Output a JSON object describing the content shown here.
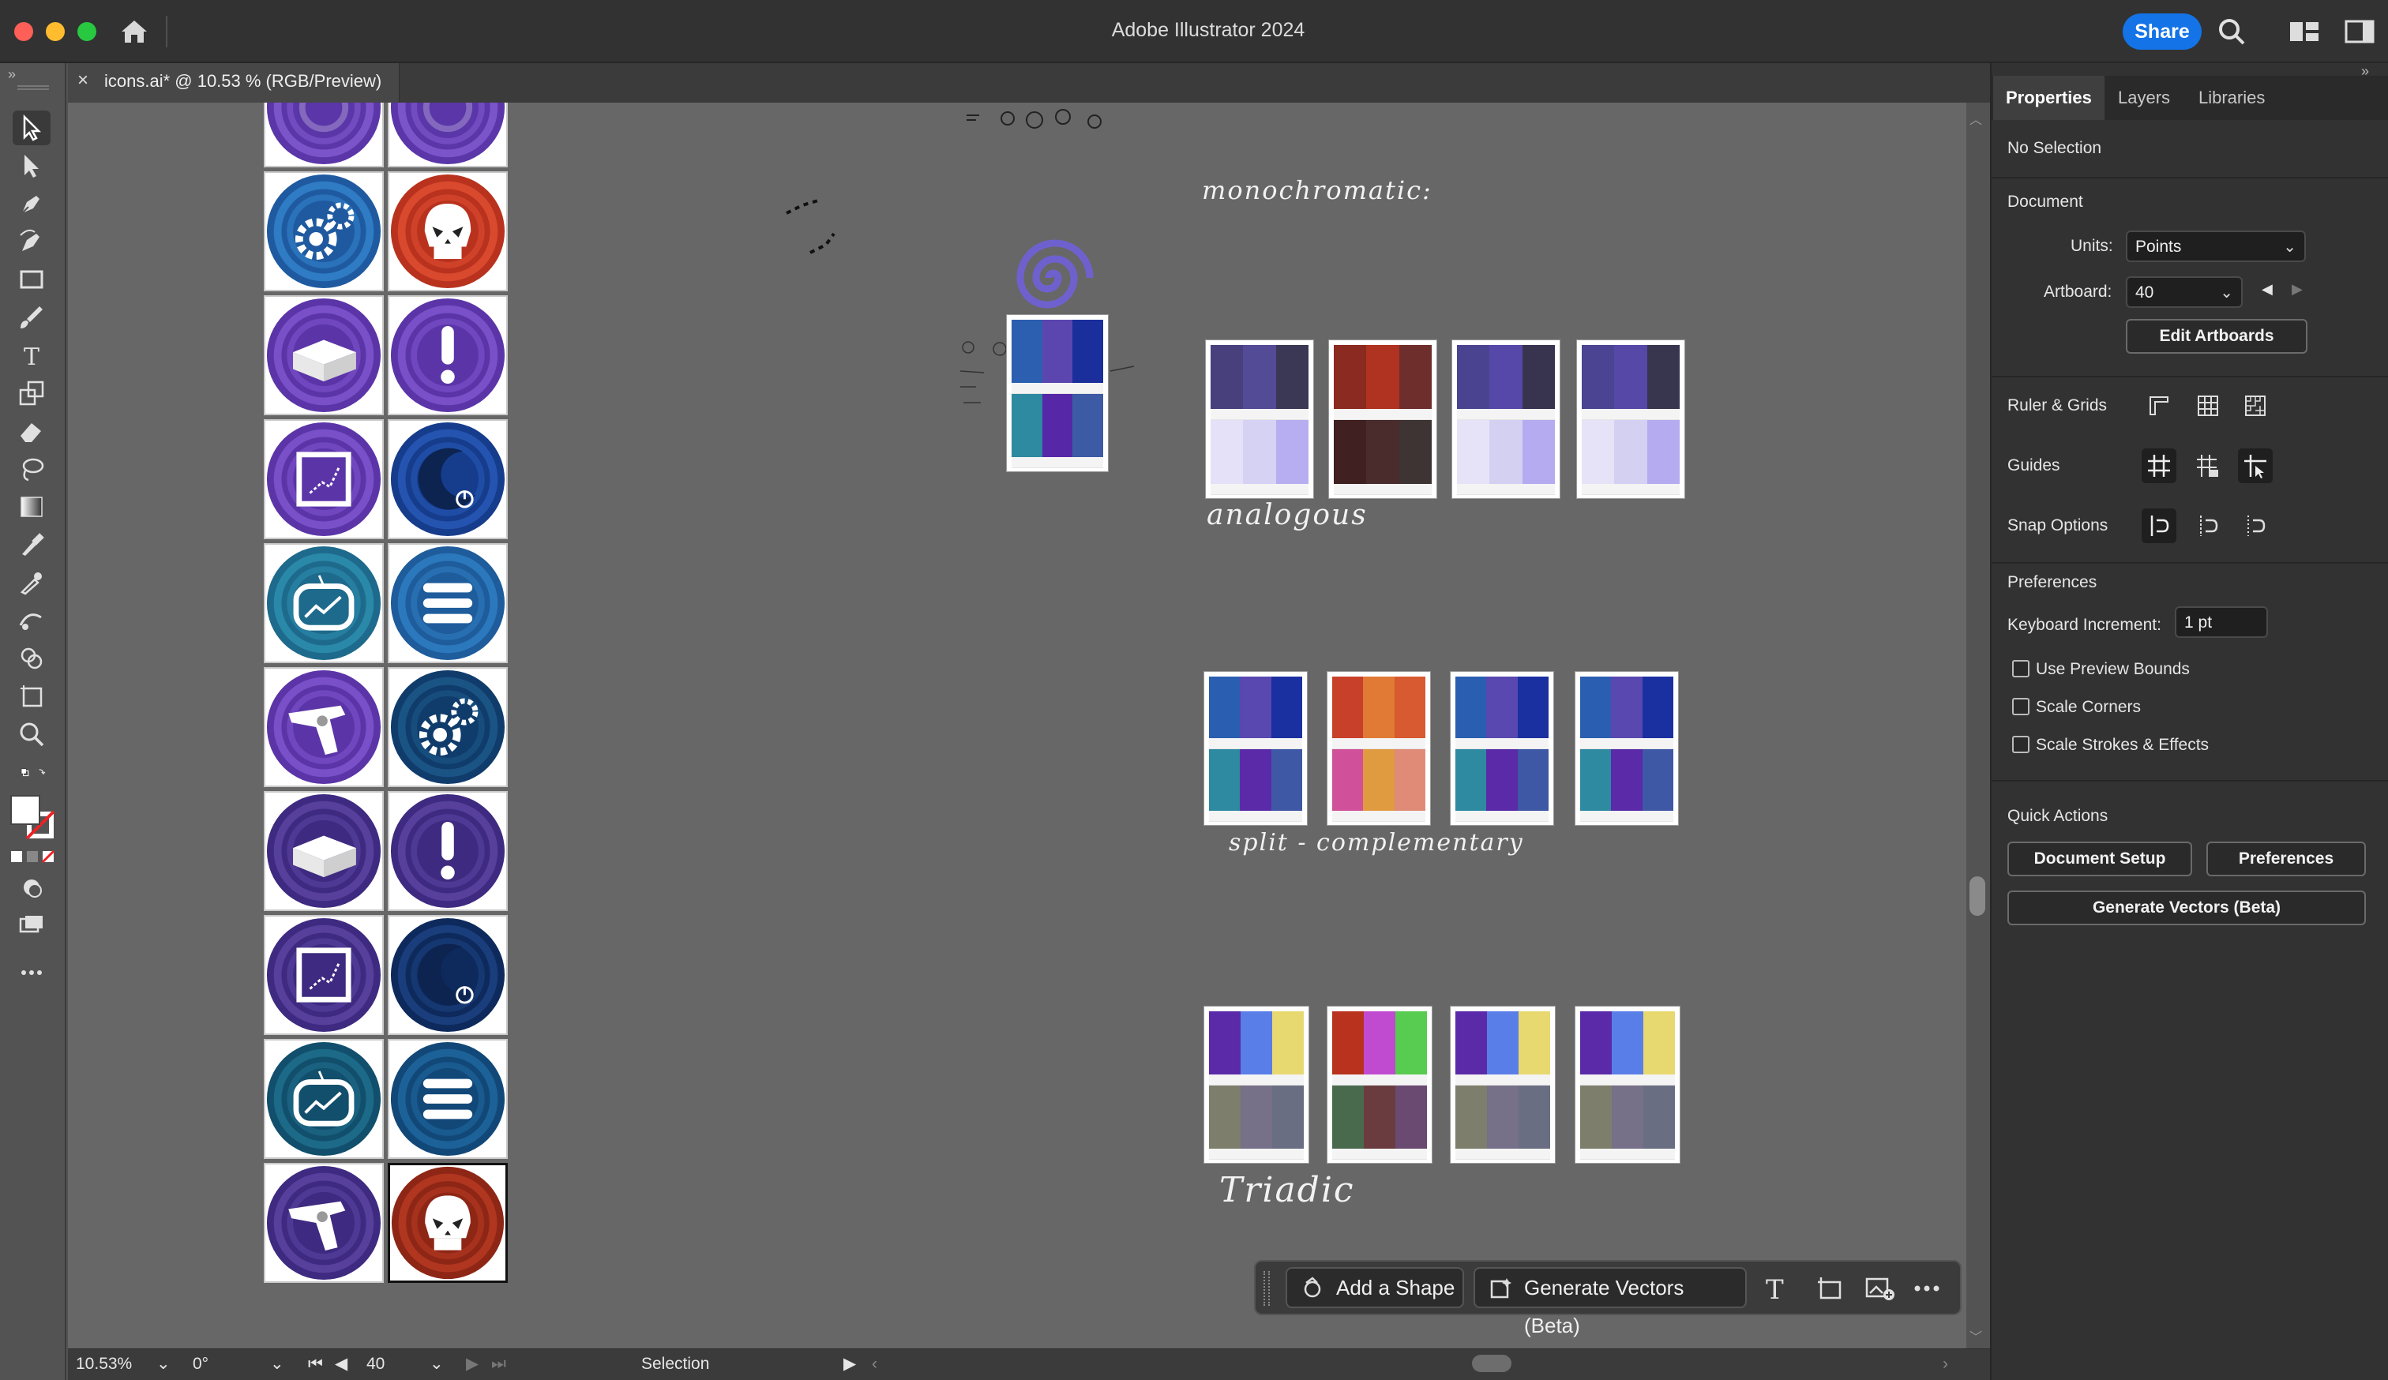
{
  "window": {
    "title": "Adobe Illustrator 2024",
    "share_label": "Share"
  },
  "document": {
    "tab_title": "icons.ai* @ 10.53 % (RGB/Preview)",
    "close_glyph": "×"
  },
  "status_bar": {
    "zoom": "10.53%",
    "rotation": "0°",
    "artboard": "40",
    "mode": "Selection"
  },
  "canvas_labels": {
    "monochromatic": "monochromatic:",
    "analogous": "analogous",
    "split_complementary": "split - complementary",
    "triadic": "Triadic"
  },
  "icons": [
    {
      "name": "spiral",
      "bg": "#5a36a8",
      "ring": "#7b54c9",
      "glyph": "spiral"
    },
    {
      "name": "spiral",
      "bg": "#5a36a8",
      "ring": "#7b54c9",
      "glyph": "spiral"
    },
    {
      "name": "gears",
      "bg": "#1f5aa0",
      "ring": "#2f7cc4",
      "glyph": "gears"
    },
    {
      "name": "skull",
      "bg": "#b8321e",
      "ring": "#d9492e",
      "glyph": "skull"
    },
    {
      "name": "briefcase",
      "bg": "#5b35a8",
      "ring": "#7950c8",
      "glyph": "case"
    },
    {
      "name": "exclamation",
      "bg": "#5b35a8",
      "ring": "#7950c8",
      "glyph": "excl"
    },
    {
      "name": "chart-frame",
      "bg": "#5b35a8",
      "ring": "#7950c8",
      "glyph": "frame"
    },
    {
      "name": "moon",
      "bg": "#163c8c",
      "ring": "#2454b0",
      "glyph": "moon"
    },
    {
      "name": "tv-chart",
      "bg": "#1e6a8c",
      "ring": "#2a88a8",
      "glyph": "tv"
    },
    {
      "name": "menu",
      "bg": "#1e5c9c",
      "ring": "#2c78bc",
      "glyph": "menu"
    },
    {
      "name": "revolver",
      "bg": "#5b35a8",
      "ring": "#7950c8",
      "glyph": "gun"
    },
    {
      "name": "gears-dark",
      "bg": "#103c6c",
      "ring": "#1a5484",
      "glyph": "gears"
    },
    {
      "name": "briefcase-dark",
      "bg": "#3e2a80",
      "ring": "#56409c",
      "glyph": "case"
    },
    {
      "name": "exclamation-dark",
      "bg": "#3e2a80",
      "ring": "#56409c",
      "glyph": "excl"
    },
    {
      "name": "chart-frame-dark",
      "bg": "#3e2a80",
      "ring": "#56409c",
      "glyph": "frame"
    },
    {
      "name": "moon-dark",
      "bg": "#0e2a5c",
      "ring": "#1a3e7c",
      "glyph": "moon"
    },
    {
      "name": "tv-chart-dark",
      "bg": "#114f6c",
      "ring": "#1c6a88",
      "glyph": "tv"
    },
    {
      "name": "menu-dark",
      "bg": "#124878",
      "ring": "#1c6298",
      "glyph": "menu"
    },
    {
      "name": "revolver-dark",
      "bg": "#3e2a80",
      "ring": "#56409c",
      "glyph": "gun"
    },
    {
      "name": "skull-dark",
      "bg": "#8e2616",
      "ring": "#b03620",
      "glyph": "skull"
    }
  ],
  "palettes": {
    "reference": [
      "#2c5fb0",
      "#5b46b0",
      "#1b2f9c",
      "#2e8aa0",
      "#5628a8",
      "#3d5aa4"
    ],
    "monochromatic": [
      [
        "#47407c",
        "#534b96",
        "#3a3854",
        "#e4e1f8",
        "#d6d2f4",
        "#b7aef2"
      ],
      [
        "#8a2a20",
        "#b03220",
        "#6e2e2c",
        "#402020",
        "#4a2c2c",
        "#3e3434"
      ],
      [
        "#4a4490",
        "#5548a8",
        "#383450",
        "#e6e3f8",
        "#d4d0f2",
        "#b4abf0"
      ],
      [
        "#4a4492",
        "#5548a6",
        "#38364f",
        "#e6e3f8",
        "#d4d0f2",
        "#b4abf0"
      ]
    ],
    "analogous": [
      [
        "#2a5eb0",
        "#5848b0",
        "#1a30a0",
        "#2e8aa0",
        "#5a2aa8",
        "#3e58a6"
      ],
      [
        "#c8402a",
        "#e07a34",
        "#d85a30",
        "#d0509a",
        "#e09a40",
        "#e08a78"
      ],
      [
        "#2a5eb0",
        "#5848b0",
        "#1a30a0",
        "#2e8aa0",
        "#5a2aa8",
        "#3e58a6"
      ],
      [
        "#2a5eb0",
        "#5848b0",
        "#1a30a0",
        "#2e8aa0",
        "#5a2aa8",
        "#3e58a6"
      ]
    ],
    "split": [
      [
        "#5a2aa8",
        "#5a7ee8",
        "#e8d870",
        "#7e7e6c",
        "#767088",
        "#6a6e82"
      ],
      [
        "#b8321e",
        "#c04ad0",
        "#58cc50",
        "#4a6a4e",
        "#6a3c40",
        "#6a4a70"
      ],
      [
        "#5a2aa8",
        "#5a7ee8",
        "#e8d870",
        "#7e7e6c",
        "#767088",
        "#6a6e82"
      ],
      [
        "#5a2aa8",
        "#5a7ee8",
        "#e8d870",
        "#7e7e6c",
        "#767088",
        "#6a6e82"
      ]
    ]
  },
  "right_panel": {
    "tabs": [
      "Properties",
      "Layers",
      "Libraries"
    ],
    "selection": "No Selection",
    "document_heading": "Document",
    "units_label": "Units:",
    "units_value": "Points",
    "artboard_label": "Artboard:",
    "artboard_value": "40",
    "edit_artboards": "Edit Artboards",
    "ruler_grids": "Ruler & Grids",
    "guides": "Guides",
    "snap_options": "Snap Options",
    "preferences_heading": "Preferences",
    "keyboard_increment_label": "Keyboard Increment:",
    "keyboard_increment_value": "1 pt",
    "use_preview_bounds": "Use Preview Bounds",
    "scale_corners": "Scale Corners",
    "scale_strokes": "Scale Strokes & Effects",
    "quick_actions": "Quick Actions",
    "document_setup": "Document Setup",
    "preferences_btn": "Preferences",
    "generate_vectors": "Generate Vectors (Beta)"
  },
  "float_bar": {
    "add_shape": "Add a Shape",
    "generate_vectors": "Generate Vectors (Beta)"
  }
}
